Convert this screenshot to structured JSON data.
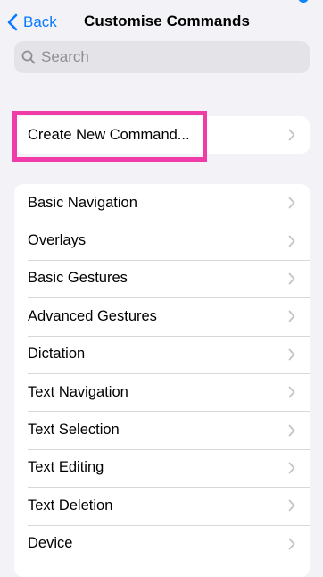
{
  "nav": {
    "back_label": "Back",
    "title": "Customise Commands"
  },
  "search": {
    "placeholder": "Search"
  },
  "create": {
    "label": "Create New Command..."
  },
  "commands": [
    "Basic Navigation",
    "Overlays",
    "Basic Gestures",
    "Advanced Gestures",
    "Dictation",
    "Text Navigation",
    "Text Selection",
    "Text Editing",
    "Text Deletion",
    "Device"
  ],
  "colors": {
    "accent": "#0a7aff",
    "highlight": "#ef3ca9",
    "background": "#f2f2f7"
  },
  "icons": {
    "back": "chevron-left-icon",
    "search": "search-icon",
    "disclosure": "chevron-right-icon"
  }
}
